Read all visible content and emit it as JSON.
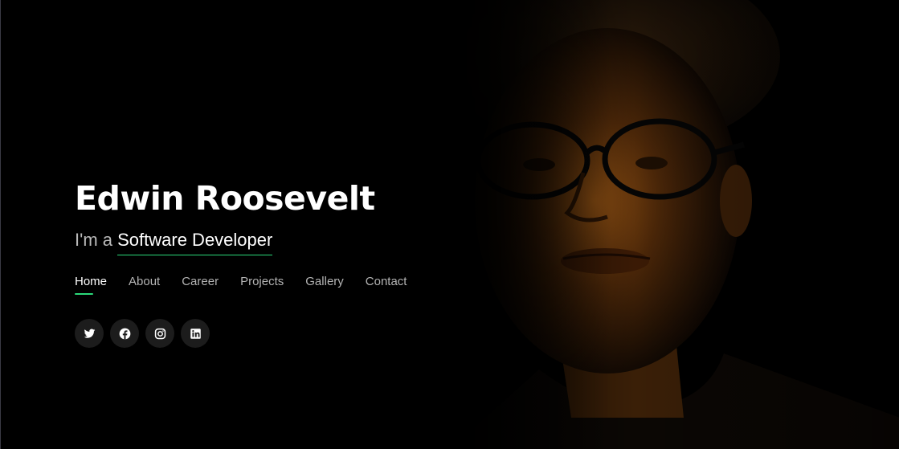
{
  "hero": {
    "name": "Edwin Roosevelt",
    "tagline_prefix": "I'm a",
    "tagline_role": "Software Developer"
  },
  "nav": {
    "items": [
      {
        "label": "Home",
        "active": true
      },
      {
        "label": "About"
      },
      {
        "label": "Career"
      },
      {
        "label": "Projects"
      },
      {
        "label": "Gallery"
      },
      {
        "label": "Contact"
      }
    ]
  },
  "social": {
    "icons": [
      "twitter-icon",
      "facebook-icon",
      "instagram-icon",
      "linkedin-icon"
    ]
  },
  "colors": {
    "background": "#000000",
    "accent": "#2bd97a",
    "text_primary": "#ffffff",
    "text_muted": "#b4b4b4",
    "icon_button_bg": "#1c1c1c"
  }
}
